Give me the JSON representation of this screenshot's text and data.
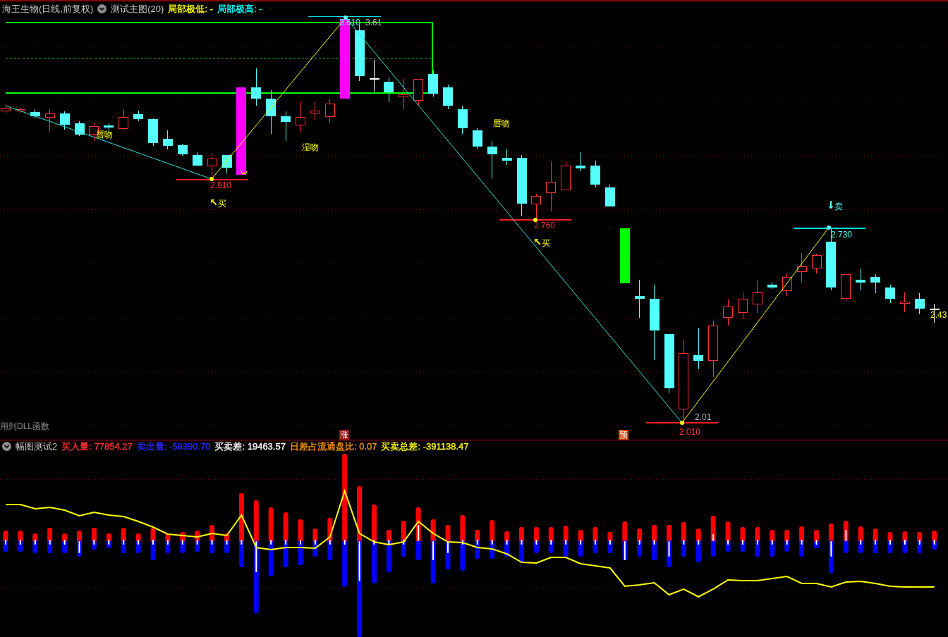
{
  "main_chart": {
    "title": "海王生物(日线,前复权)",
    "indicator": "测试主图(20)",
    "legend": [
      {
        "label": "局部极低: -",
        "color": "#ffff00"
      },
      {
        "label": "局部极高: -",
        "color": "#00ffff"
      }
    ],
    "annotations": [
      {
        "kind": "high",
        "text": "3.610"
      },
      {
        "kind": "reference",
        "text": "3.61"
      },
      {
        "kind": "pattern",
        "text": "唇吻"
      },
      {
        "kind": "pattern",
        "text": "湿吻"
      },
      {
        "kind": "low",
        "text": "2.910"
      },
      {
        "kind": "buy",
        "text": "买"
      },
      {
        "kind": "pattern",
        "text": "唇吻"
      },
      {
        "kind": "low",
        "text": "2.760"
      },
      {
        "kind": "buy",
        "text": "买"
      },
      {
        "kind": "sell",
        "text": "卖"
      },
      {
        "kind": "high",
        "text": "2.730"
      },
      {
        "kind": "last",
        "text": "2.43"
      },
      {
        "kind": "reference",
        "text": "2.01"
      },
      {
        "kind": "low",
        "text": "2.010"
      }
    ],
    "note": "用到DLL函数",
    "badges": [
      {
        "kind": "rise",
        "text": "涨"
      },
      {
        "kind": "forecast",
        "text": "预"
      }
    ]
  },
  "sub_chart": {
    "indicator": "幅图测试2",
    "legend": [
      {
        "label": "买入量: 77854.27",
        "color": "#ff3232"
      },
      {
        "label": "卖出量: -58390.70",
        "color": "#2828ff"
      },
      {
        "label": "买卖差: 19463.57",
        "color": "#ffffff"
      },
      {
        "label": "日差占流通盘比: 0.07",
        "color": "#ff9900"
      },
      {
        "label": "买卖总差: -391138.47",
        "color": "#ffff00"
      }
    ]
  }
}
